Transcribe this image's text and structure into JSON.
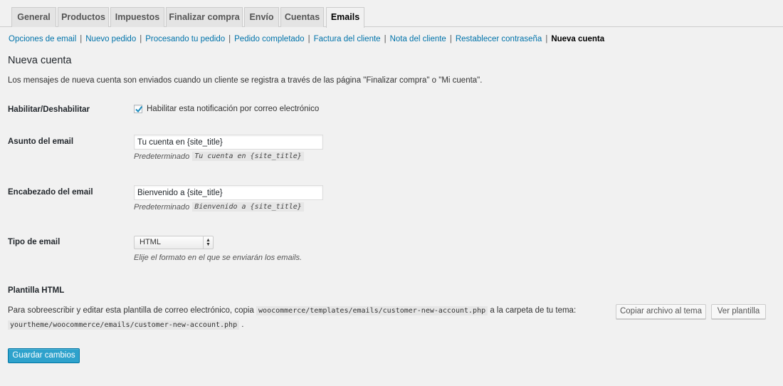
{
  "tabs": [
    {
      "label": "General"
    },
    {
      "label": "Productos"
    },
    {
      "label": "Impuestos"
    },
    {
      "label": "Finalizar compra"
    },
    {
      "label": "Envío"
    },
    {
      "label": "Cuentas"
    },
    {
      "label": "Emails"
    }
  ],
  "subnav": {
    "links": [
      "Opciones de email",
      "Nuevo pedido",
      "Procesando tu pedido",
      "Pedido completado",
      "Factura del cliente",
      "Nota del cliente",
      "Restablecer contraseña"
    ],
    "current": "Nueva cuenta",
    "separator": "|"
  },
  "page": {
    "title": "Nueva cuenta",
    "description": "Los mensajes de nueva cuenta son enviados cuando un cliente se registra a través de las página \"Finalizar compra\" o \"Mi cuenta\"."
  },
  "enable": {
    "label": "Habilitar/Deshabilitar",
    "checkbox_label": "Habilitar esta notificación por correo electrónico",
    "checked": true
  },
  "subject": {
    "label": "Asunto del email",
    "value": "Tu cuenta en {site_title}",
    "default_prefix": "Predeterminado",
    "default_value": "Tu cuenta en {site_title}"
  },
  "heading": {
    "label": "Encabezado del email",
    "value": "Bienvenido a {site_title}",
    "default_prefix": "Predeterminado",
    "default_value": "Bienvenido a {site_title}"
  },
  "email_type": {
    "label": "Tipo de email",
    "selected": "HTML",
    "hint": "Elije el formato en el que se enviarán los emails."
  },
  "template": {
    "heading": "Plantilla HTML",
    "text_before": "Para sobreescribir y editar esta plantilla de correo electrónico, copia",
    "source_path": "woocommerce/templates/emails/customer-new-account.php",
    "text_middle": "a la carpeta de tu tema:",
    "dest_path": "yourtheme/woocommerce/emails/customer-new-account.php",
    "text_after": ".",
    "copy_button": "Copiar archivo al tema",
    "view_button": "Ver plantilla"
  },
  "save_button": "Guardar cambios",
  "colors": {
    "link": "#0073aa",
    "primary_button": "#2ea2cc",
    "checkmark": "#1e8cbe"
  }
}
